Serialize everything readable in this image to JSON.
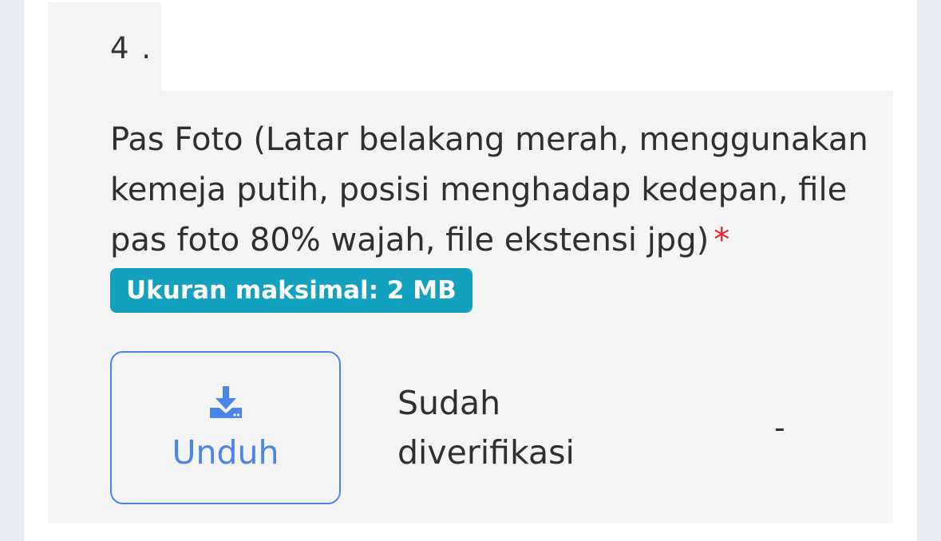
{
  "item": {
    "number": "4 .",
    "title": "Pas Foto (Latar belakang merah, menggunakan kemeja putih, posisi menghadap kedepan, file pas foto 80% wajah, file ekstensi jpg)",
    "required_mark": "*",
    "size_badge": "Ukuran maksimal: 2 MB",
    "download_label": "Unduh",
    "download_icon": "download-icon",
    "status": "Sudah diverifikasi",
    "note": "-"
  },
  "colors": {
    "badge": "#12a1be",
    "accent": "#4a86e8",
    "required": "#e4252d",
    "panel": "#f4f4f4"
  }
}
